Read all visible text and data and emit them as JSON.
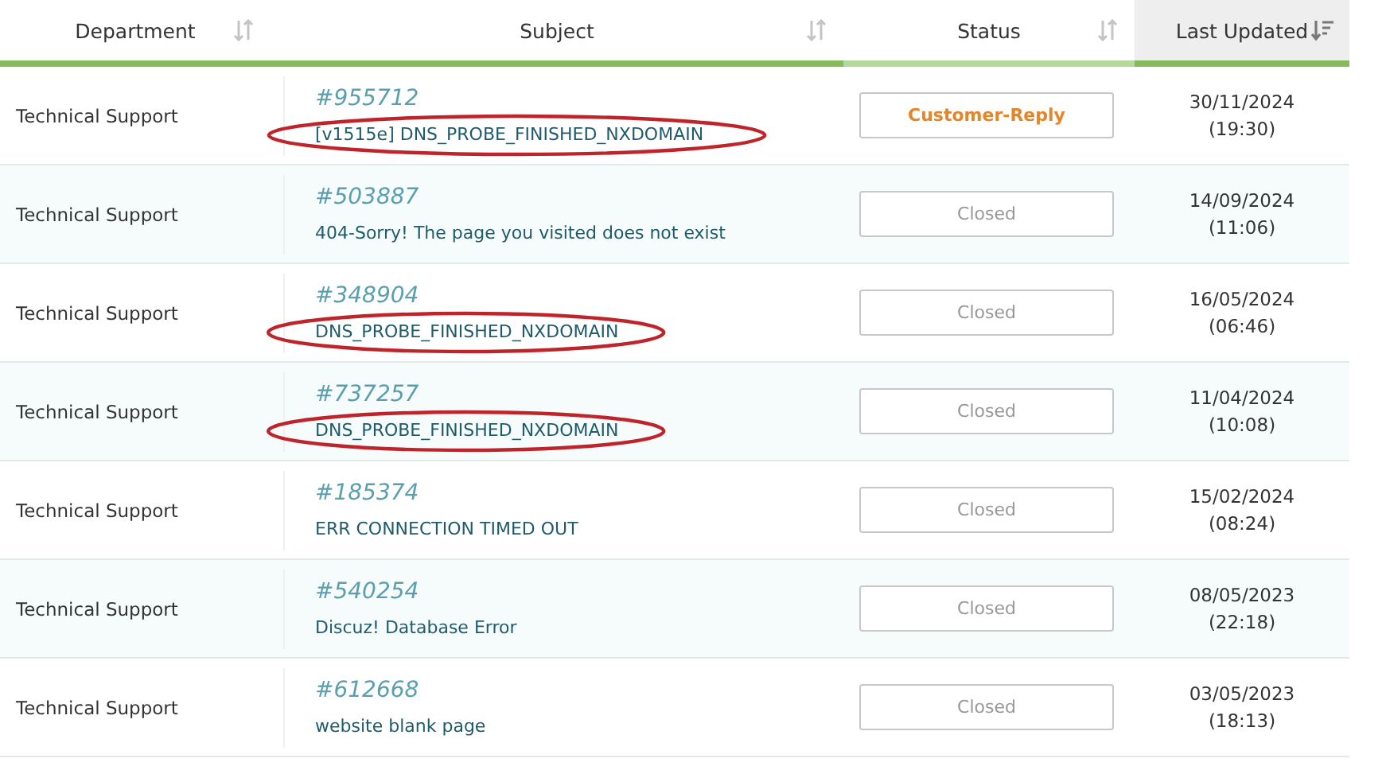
{
  "columns": [
    {
      "label": "Department",
      "sorted": false
    },
    {
      "label": "Subject",
      "sorted": false
    },
    {
      "label": "Status",
      "sorted": false
    },
    {
      "label": "Last Updated",
      "sorted": true
    }
  ],
  "rows": [
    {
      "department": "Technical Support",
      "ticket": "#955712",
      "subject": "[v1515e] DNS_PROBE_FINISHED_NXDOMAIN",
      "circled": true,
      "status": "Customer-Reply",
      "kind": "customer-reply",
      "date": "30/11/2024",
      "time": "(19:30)"
    },
    {
      "department": "Technical Support",
      "ticket": "#503887",
      "subject": "404-Sorry! The page you visited does not exist",
      "circled": false,
      "status": "Closed",
      "kind": "closed",
      "date": "14/09/2024",
      "time": "(11:06)"
    },
    {
      "department": "Technical Support",
      "ticket": "#348904",
      "subject": "DNS_PROBE_FINISHED_NXDOMAIN",
      "circled": true,
      "status": "Closed",
      "kind": "closed",
      "date": "16/05/2024",
      "time": "(06:46)"
    },
    {
      "department": "Technical Support",
      "ticket": "#737257",
      "subject": "DNS_PROBE_FINISHED_NXDOMAIN",
      "circled": true,
      "status": "Closed",
      "kind": "closed",
      "date": "11/04/2024",
      "time": "(10:08)"
    },
    {
      "department": "Technical Support",
      "ticket": "#185374",
      "subject": "ERR CONNECTION TIMED OUT",
      "circled": false,
      "status": "Closed",
      "kind": "closed",
      "date": "15/02/2024",
      "time": "(08:24)"
    },
    {
      "department": "Technical Support",
      "ticket": "#540254",
      "subject": "Discuz! Database Error",
      "circled": false,
      "status": "Closed",
      "kind": "closed",
      "date": "08/05/2023",
      "time": "(22:18)"
    },
    {
      "department": "Technical Support",
      "ticket": "#612668",
      "subject": "website blank page",
      "circled": false,
      "status": "Closed",
      "kind": "closed",
      "date": "03/05/2023",
      "time": "(18:13)"
    }
  ]
}
